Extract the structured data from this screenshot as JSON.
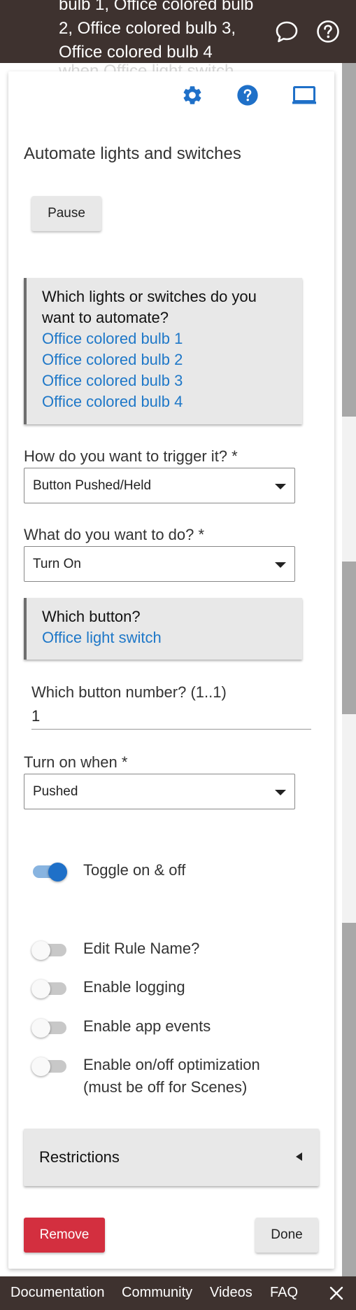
{
  "header": {
    "title_partial": "bulb 1, Office colored bulb 2, Office colored bulb 3, Office colored bulb 4",
    "ghost_text": "when Office light switch",
    "chat_icon": "chat-bubble-icon",
    "help_icon": "help-circle-icon"
  },
  "toolbar": {
    "settings_icon": "gear-icon",
    "help_icon": "help-icon",
    "display_icon": "laptop-icon",
    "accent": "#1f70c8"
  },
  "app": {
    "title": "Automate lights and switches",
    "pause_label": "Pause"
  },
  "devices": {
    "question": "Which lights or switches do you want to automate?",
    "items": [
      "Office colored bulb 1",
      "Office colored bulb 2",
      "Office colored bulb 3",
      "Office colored bulb 4"
    ]
  },
  "trigger": {
    "label": "How do you want to trigger it? *",
    "value": "Button Pushed/Held"
  },
  "action": {
    "label": "What do you want to do? *",
    "value": "Turn On"
  },
  "button_device": {
    "question": "Which button?",
    "value": "Office light switch"
  },
  "button_number": {
    "label": "Which button number? (1..1)",
    "value": "1"
  },
  "turn_on_when": {
    "label": "Turn on when *",
    "value": "Pushed"
  },
  "toggles": [
    {
      "label": "Toggle on & off",
      "on": true
    },
    {
      "label": "Edit Rule Name?",
      "on": false
    },
    {
      "label": "Enable logging",
      "on": false
    },
    {
      "label": "Enable app events",
      "on": false
    },
    {
      "label": "Enable on/off optimization (must be off for Scenes)",
      "on": false
    }
  ],
  "restrictions": {
    "label": "Restrictions"
  },
  "actions": {
    "remove_label": "Remove",
    "done_label": "Done",
    "remove_color": "#d32f3f"
  },
  "footer": {
    "links": [
      "Documentation",
      "Community",
      "Videos",
      "FAQ"
    ],
    "close_icon": "close-icon"
  }
}
